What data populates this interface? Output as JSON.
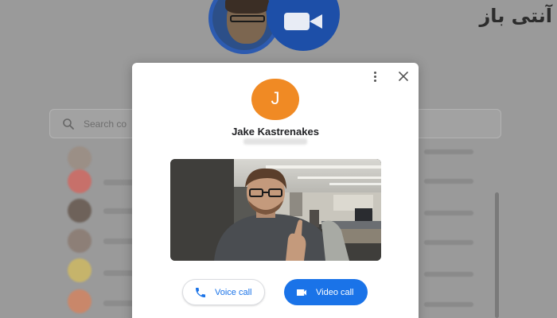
{
  "background": {
    "search": {
      "placeholder": "Search co"
    },
    "watermark": "آنتی باز"
  },
  "dialog": {
    "avatar_letter": "J",
    "contact_name": "Jake Kastrenakes",
    "buttons": {
      "voice_label": "Voice call",
      "video_label": "Video call"
    }
  },
  "colors": {
    "avatar_bg": "#f08a24",
    "accent_blue": "#1a73e8",
    "duo_logo_blue": "#1d4fa8"
  },
  "icons": {
    "more": "more-vert-icon",
    "close": "close-icon",
    "voice": "phone-icon",
    "video": "videocam-icon",
    "search": "search-icon"
  }
}
